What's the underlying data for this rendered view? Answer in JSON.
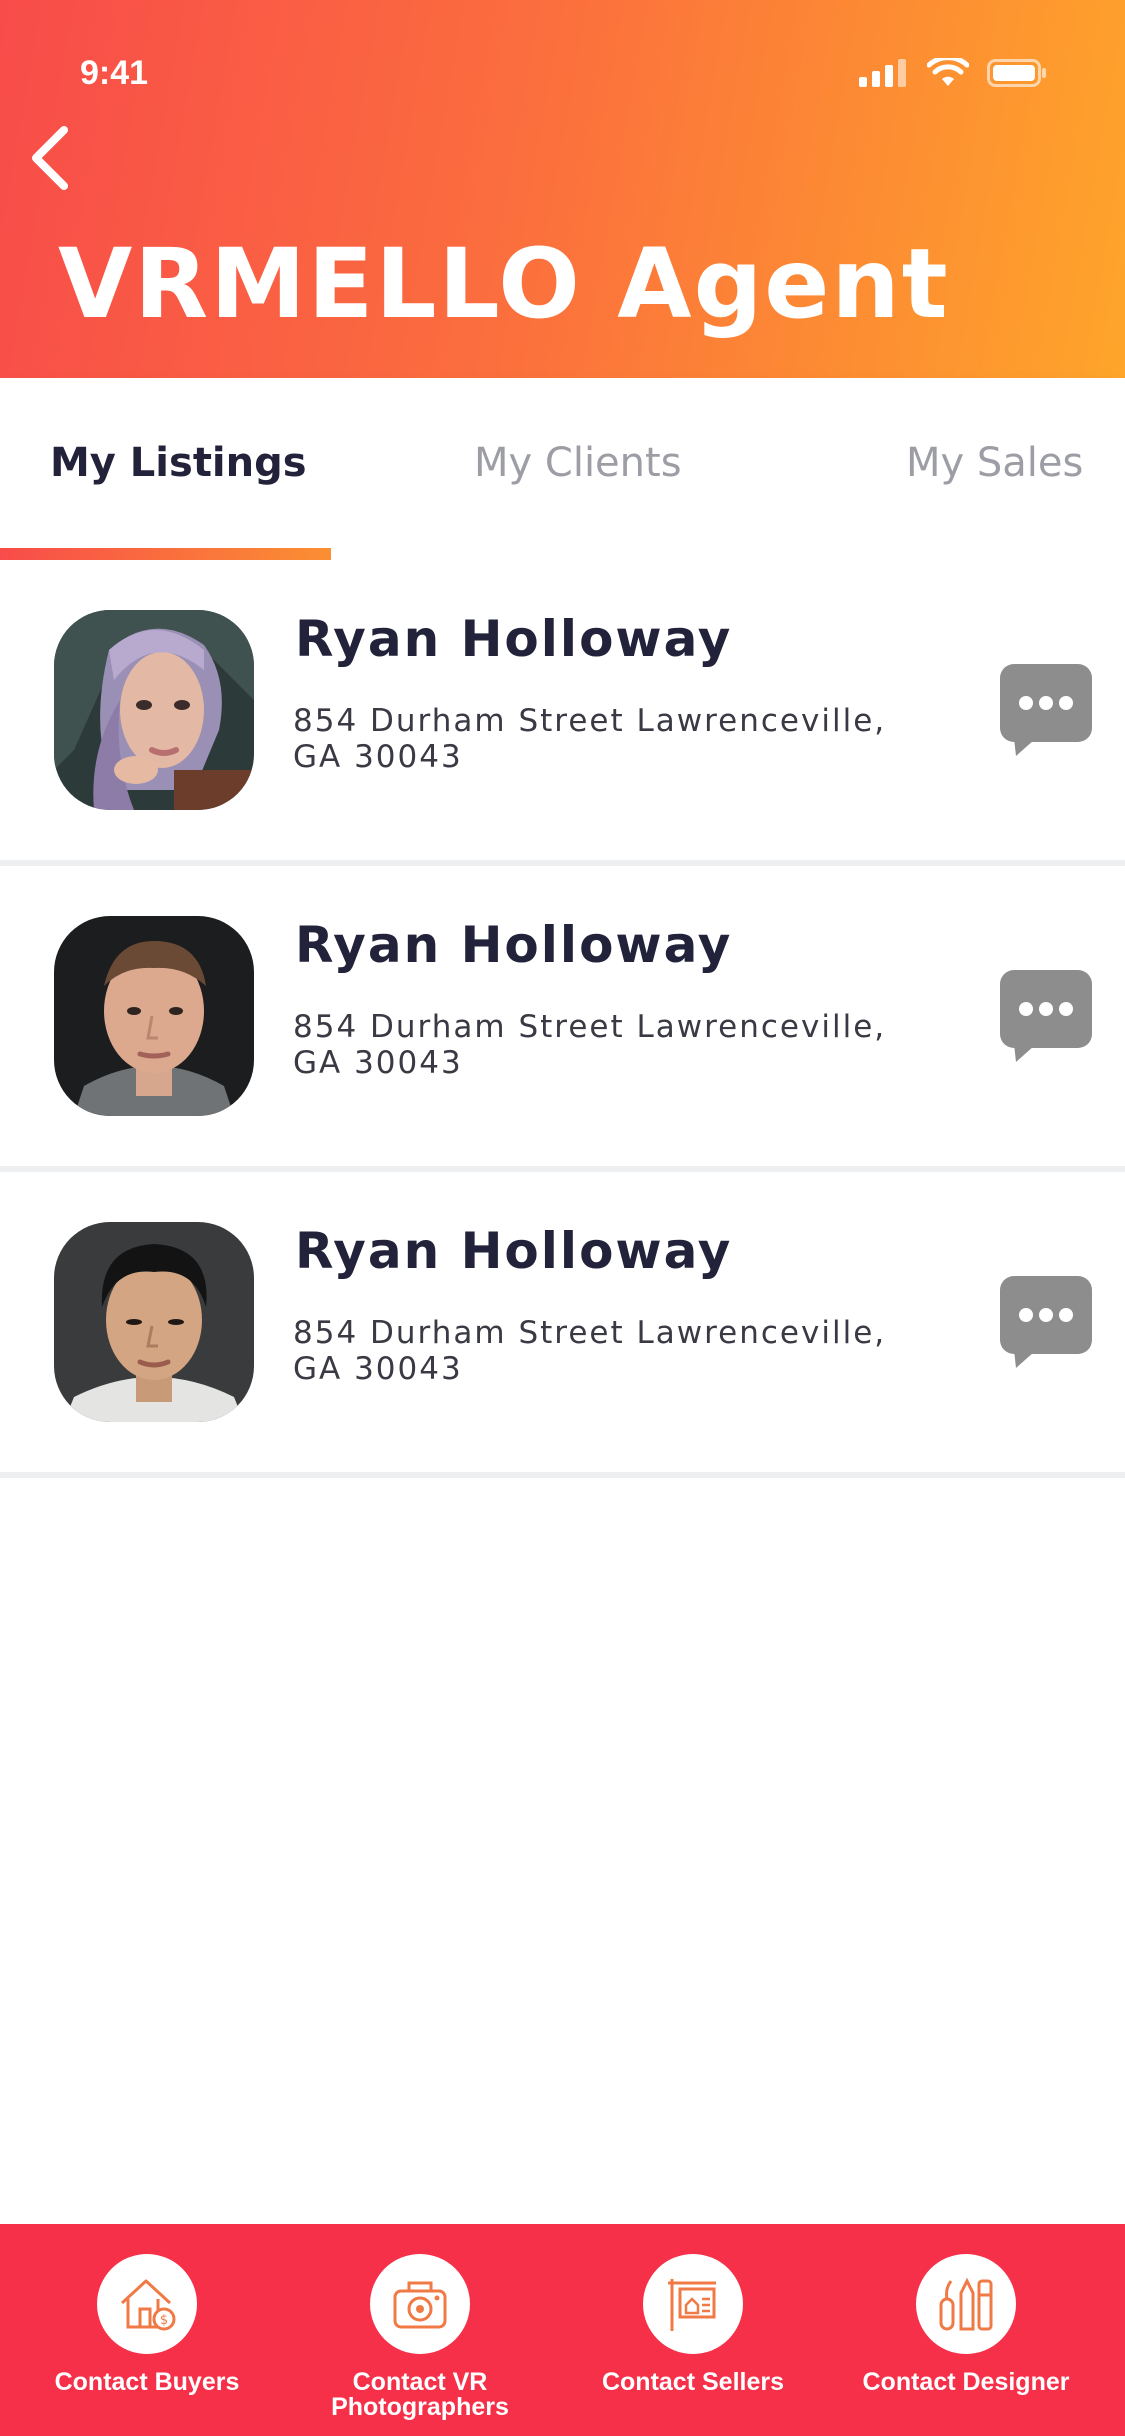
{
  "status_bar": {
    "time": "9:41"
  },
  "header": {
    "title": "VRMELLO Agent"
  },
  "tabs": [
    {
      "label": "My Listings",
      "active": true
    },
    {
      "label": "My Clients",
      "active": false
    },
    {
      "label": "My Sales",
      "active": false
    }
  ],
  "listings": [
    {
      "name": "Ryan Holloway",
      "address": "854 Durham Street Lawrenceville, GA 30043"
    },
    {
      "name": "Ryan Holloway",
      "address": "854 Durham Street Lawrenceville, GA 30043"
    },
    {
      "name": "Ryan Holloway",
      "address": "854 Durham Street Lawrenceville, GA 30043"
    }
  ],
  "bottom_actions": [
    {
      "label": "Contact Buyers",
      "icon": "house-sale-icon"
    },
    {
      "label": "Contact VR Photographers",
      "icon": "camera-icon"
    },
    {
      "label": "Contact Sellers",
      "icon": "sale-sign-icon"
    },
    {
      "label": "Contact Designer",
      "icon": "design-tools-icon"
    }
  ],
  "colors": {
    "header_gradient_start": "#f84c4a",
    "header_gradient_end": "#fea52a",
    "bottom_bar": "#f7304a",
    "icon_accent": "#f07a45",
    "chat_bubble": "#8d8d8d"
  }
}
